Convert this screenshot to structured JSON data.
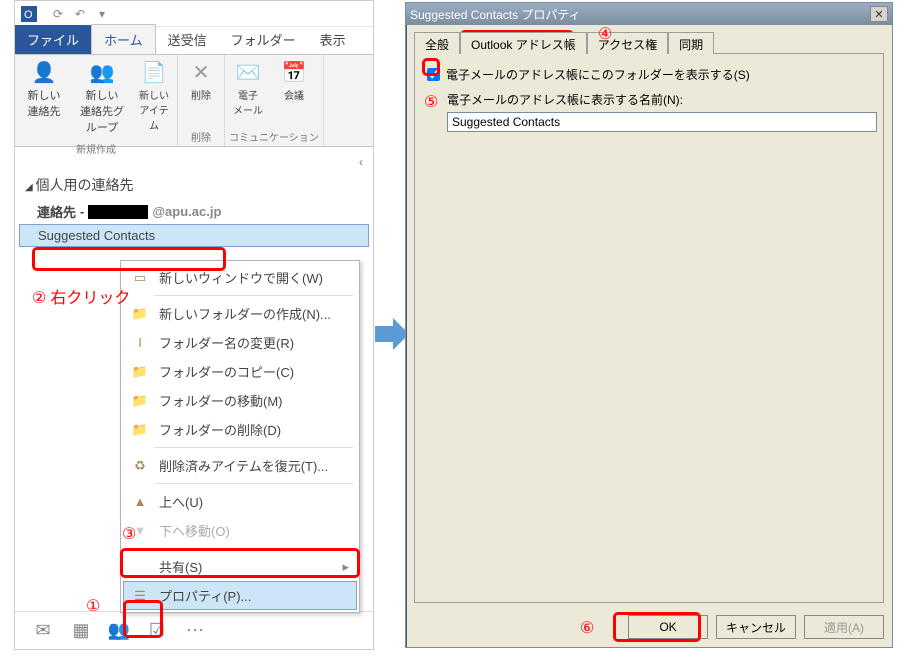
{
  "ribbonTabs": {
    "file": "ファイル",
    "home": "ホーム",
    "sendrecv": "送受信",
    "folder": "フォルダー",
    "view": "表示"
  },
  "ribbon": {
    "newContact": "新しい\n連絡先",
    "newGroup": "新しい\n連絡先グループ",
    "newItems": "新しい\nアイテム",
    "groupNew": "新規作成",
    "delete": "削除",
    "groupDelete": "削除",
    "email": "電子\nメール",
    "meeting": "会議",
    "groupComm": "コミュニケーション"
  },
  "nav": {
    "header": "個人用の連絡先",
    "contacts": "連絡先",
    "contactsSuffix": "@apu.ac.jp",
    "suggested": "Suggested Contacts"
  },
  "ctx": {
    "openNewWindow": "新しいウィンドウで開く(W)",
    "newFolder": "新しいフォルダーの作成(N)...",
    "renameFolder": "フォルダー名の変更(R)",
    "copyFolder": "フォルダーのコピー(C)",
    "moveFolder": "フォルダーの移動(M)",
    "deleteFolder": "フォルダーの削除(D)",
    "restoreDeleted": "削除済みアイテムを復元(T)...",
    "moveUp": "上へ(U)",
    "moveDown": "下へ移動(O)",
    "share": "共有(S)",
    "properties": "プロパティ(P)..."
  },
  "annots": {
    "rightClick": "右クリック",
    "n1": "①",
    "n2": "②",
    "n3": "③",
    "n4": "④",
    "n5": "⑤",
    "n6": "⑥"
  },
  "dialog": {
    "title": "Suggested Contacts プロパティ",
    "tabGeneral": "全般",
    "tabAddress": "Outlook アドレス帳",
    "tabPerm": "アクセス権",
    "tabSync": "同期",
    "chkLabel": "電子メールのアドレス帳にこのフォルダーを表示する(S)",
    "nameLabel": "電子メールのアドレス帳に表示する名前(N):",
    "nameValue": "Suggested Contacts",
    "ok": "OK",
    "cancel": "キャンセル",
    "apply": "適用(A)"
  }
}
